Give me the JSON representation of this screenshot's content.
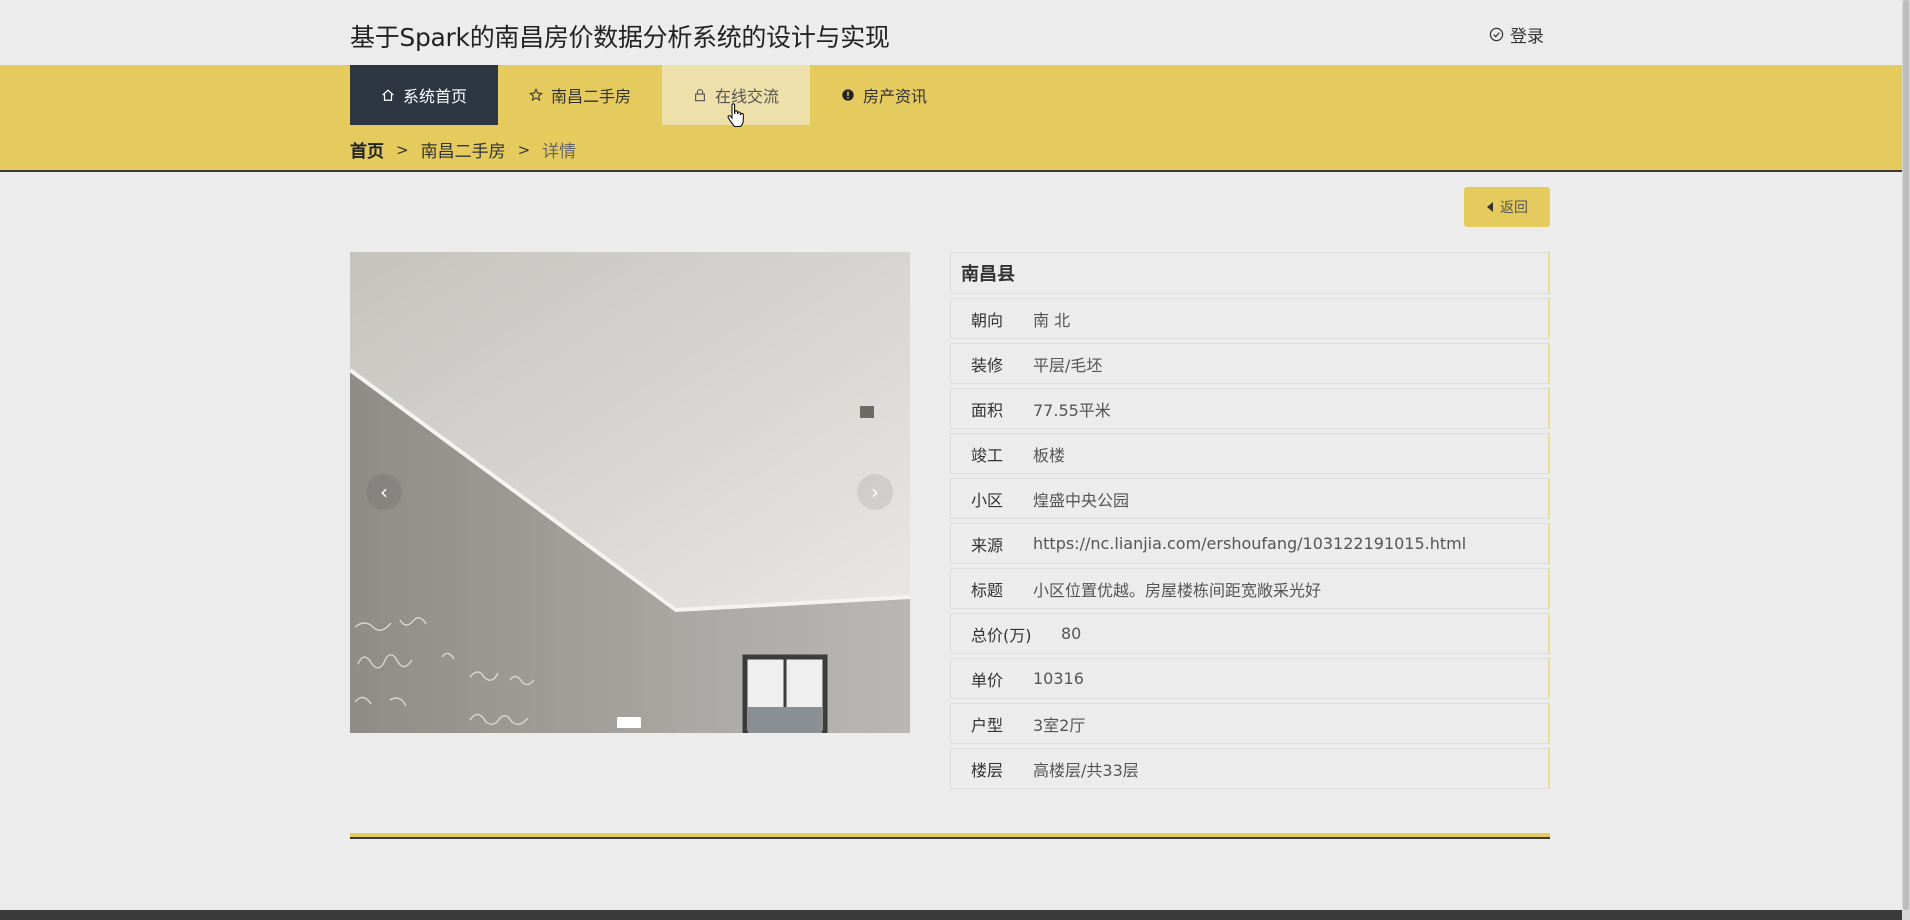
{
  "header": {
    "site_title": "基于Spark的南昌房价数据分析系统的设计与实现",
    "login_label": "登录"
  },
  "nav": {
    "items": [
      {
        "label": "系统首页",
        "icon": "home-icon"
      },
      {
        "label": "南昌二手房",
        "icon": "star-icon"
      },
      {
        "label": "在线交流",
        "icon": "lock-icon"
      },
      {
        "label": "房产资讯",
        "icon": "info-icon"
      }
    ],
    "active_index": 0,
    "hover_index": 2
  },
  "breadcrumb": {
    "items": [
      "首页",
      "南昌二手房",
      "详情"
    ],
    "separator": ">"
  },
  "back_button": {
    "label": "返回"
  },
  "carousel": {
    "prev_symbol": "‹",
    "next_symbol": "›",
    "slide_count": 1,
    "active_slide": 0
  },
  "detail": {
    "heading": "南昌县",
    "rows": [
      {
        "label": "朝向",
        "value": "南 北"
      },
      {
        "label": "装修",
        "value": "平层/毛坯"
      },
      {
        "label": "面积",
        "value": "77.55平米"
      },
      {
        "label": "竣工",
        "value": "板楼"
      },
      {
        "label": "小区",
        "value": "煌盛中央公园"
      },
      {
        "label": "来源",
        "value": "https://nc.lianjia.com/ershoufang/103122191015.html"
      },
      {
        "label": "标题",
        "value": "小区位置优越。房屋楼栋间距宽敞采光好"
      },
      {
        "label": "总价(万)",
        "value": "80"
      },
      {
        "label": "单价",
        "value": "10316"
      },
      {
        "label": "户型",
        "value": "3室2厅"
      },
      {
        "label": "楼层",
        "value": "高楼层/共33层"
      }
    ]
  },
  "colors": {
    "accent": "#e5cb5e",
    "nav_active_bg": "#2e3642",
    "nav_hover_bg": "#ede0aa",
    "page_bg": "#ececec"
  }
}
